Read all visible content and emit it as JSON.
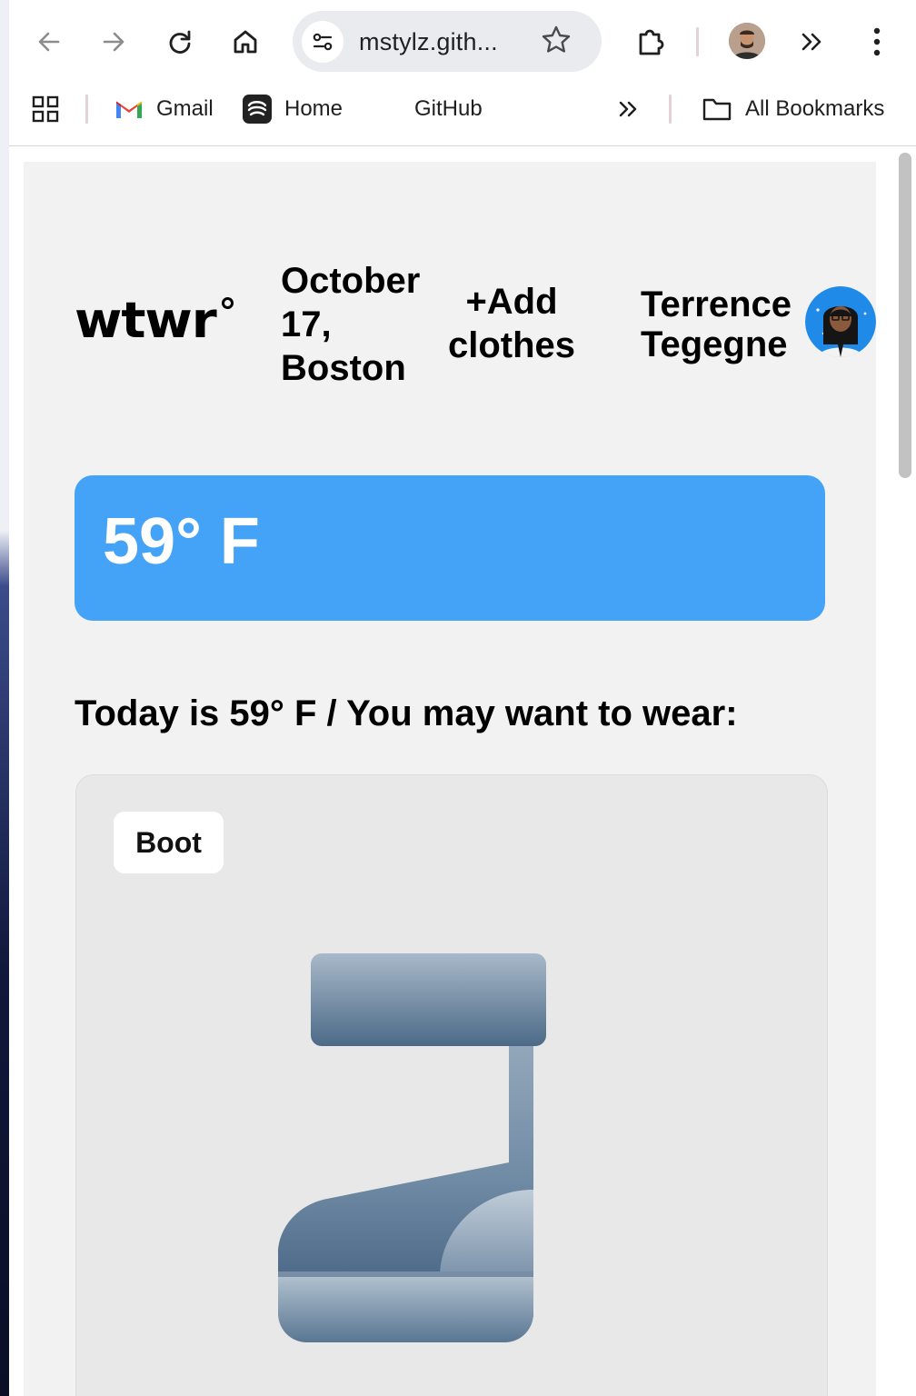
{
  "browser": {
    "url": "mstylz.gith...",
    "bookmarks": {
      "gmail": "Gmail",
      "home": "Home",
      "github": "GitHub",
      "all_bookmarks": "All Bookmarks"
    }
  },
  "header": {
    "logo": "wtwr",
    "date_location": "October 17, Boston",
    "add_clothes_label": "+Add clothes",
    "user_name": "Terrence Tegegne"
  },
  "weather": {
    "temperature": "59° F",
    "card_color": "#45a3f7"
  },
  "recommendation": {
    "text_prefix": "Today is 59° F / You may want to wear:"
  },
  "items": [
    {
      "name": "Boot",
      "icon": "boot-icon"
    }
  ],
  "colors": {
    "page_bg": "#f2f2f2",
    "card_bg": "#e8e8e8",
    "accent": "#45a3f7"
  }
}
